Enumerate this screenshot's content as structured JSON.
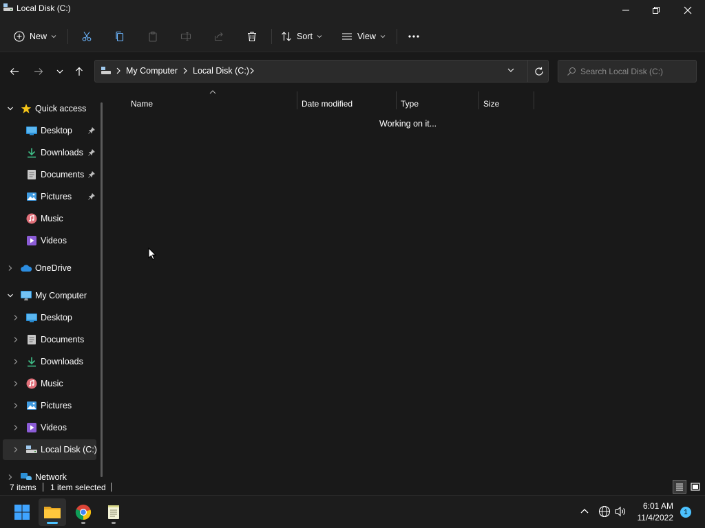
{
  "window": {
    "title": "Local Disk (C:)",
    "colors": {
      "background": "#191919",
      "chrome": "#202020",
      "accent": "#4cc2ff"
    }
  },
  "toolbar": {
    "new_label": "New",
    "sort_label": "Sort",
    "view_label": "View",
    "icons": [
      "cut-icon",
      "copy-icon",
      "paste-icon",
      "rename-icon",
      "share-icon",
      "delete-icon",
      "more-icon"
    ]
  },
  "address": {
    "breadcrumbs": [
      "My Computer",
      "Local Disk (C:)"
    ],
    "search_placeholder": "Search Local Disk (C:)"
  },
  "sidebar": {
    "quick_access": {
      "label": "Quick access",
      "items": [
        {
          "label": "Desktop",
          "icon": "desktop-icon",
          "pinned": true
        },
        {
          "label": "Downloads",
          "icon": "download-icon",
          "pinned": true
        },
        {
          "label": "Documents",
          "icon": "document-icon",
          "pinned": true
        },
        {
          "label": "Pictures",
          "icon": "picture-icon",
          "pinned": true
        },
        {
          "label": "Music",
          "icon": "music-icon",
          "pinned": false
        },
        {
          "label": "Videos",
          "icon": "video-icon",
          "pinned": false
        }
      ]
    },
    "onedrive_label": "OneDrive",
    "my_computer": {
      "label": "My Computer",
      "items": [
        {
          "label": "Desktop",
          "icon": "desktop-icon"
        },
        {
          "label": "Documents",
          "icon": "document-icon"
        },
        {
          "label": "Downloads",
          "icon": "download-icon"
        },
        {
          "label": "Music",
          "icon": "music-icon"
        },
        {
          "label": "Pictures",
          "icon": "picture-icon"
        },
        {
          "label": "Videos",
          "icon": "video-icon"
        },
        {
          "label": "Local Disk (C:)",
          "icon": "drive-icon",
          "selected": true
        }
      ]
    },
    "network_label": "Network"
  },
  "filelist": {
    "columns": [
      "Name",
      "Date modified",
      "Type",
      "Size"
    ],
    "sort_column": "Name",
    "status_message": "Working on it..."
  },
  "statusbar": {
    "item_count": "7 items",
    "selection": "1 item selected"
  },
  "taskbar": {
    "apps": [
      "start-icon",
      "file-explorer-icon",
      "chrome-icon",
      "notepad-icon"
    ],
    "time": "6:01 AM",
    "date": "11/4/2022",
    "notification_count": "1"
  }
}
